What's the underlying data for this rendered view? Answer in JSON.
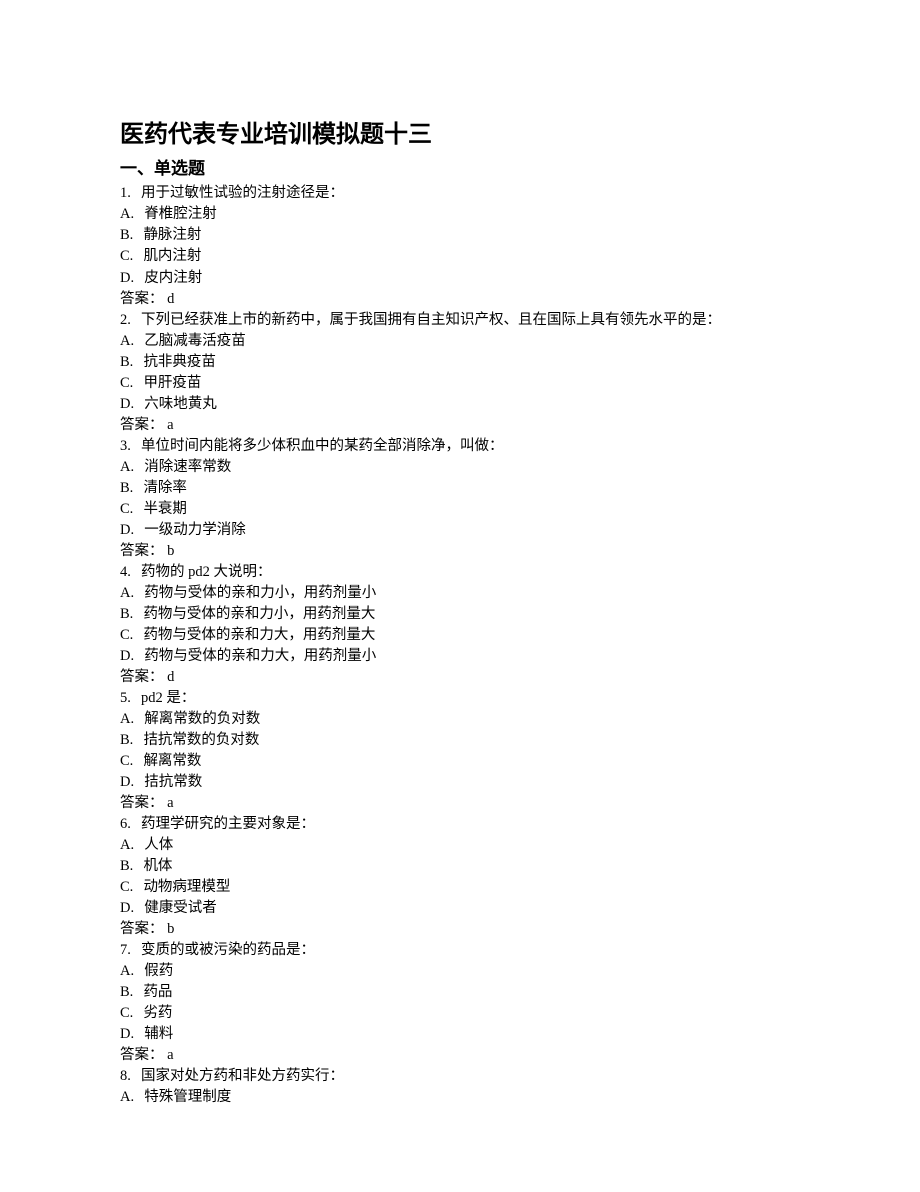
{
  "title": "医药代表专业培训模拟题十三",
  "section": "一、单选题",
  "answer_label": "答案：",
  "questions": [
    {
      "num": "1.",
      "stem": "用于过敏性试验的注射途径是：",
      "options": [
        {
          "letter": "A.",
          "text": "脊椎腔注射"
        },
        {
          "letter": "B.",
          "text": "静脉注射"
        },
        {
          "letter": "C.",
          "text": "肌内注射"
        },
        {
          "letter": "D.",
          "text": "皮内注射"
        }
      ],
      "answer": "d"
    },
    {
      "num": "2.",
      "stem": "下列已经获准上市的新药中，属于我国拥有自主知识产权、且在国际上具有领先水平的是：",
      "options": [
        {
          "letter": "A.",
          "text": "乙脑减毒活疫苗"
        },
        {
          "letter": "B.",
          "text": "抗非典疫苗"
        },
        {
          "letter": "C.",
          "text": "甲肝疫苗"
        },
        {
          "letter": "D.",
          "text": "六味地黄丸"
        }
      ],
      "answer": "a"
    },
    {
      "num": "3.",
      "stem": "单位时间内能将多少体积血中的某药全部消除净，叫做：",
      "options": [
        {
          "letter": "A.",
          "text": "消除速率常数"
        },
        {
          "letter": "B.",
          "text": "清除率"
        },
        {
          "letter": "C.",
          "text": "半衰期"
        },
        {
          "letter": "D.",
          "text": "一级动力学消除"
        }
      ],
      "answer": "b"
    },
    {
      "num": "4.",
      "stem": "药物的 pd2 大说明：",
      "options": [
        {
          "letter": "A.",
          "text": "药物与受体的亲和力小，用药剂量小"
        },
        {
          "letter": "B.",
          "text": "药物与受体的亲和力小，用药剂量大"
        },
        {
          "letter": "C.",
          "text": "药物与受体的亲和力大，用药剂量大"
        },
        {
          "letter": "D.",
          "text": "药物与受体的亲和力大，用药剂量小"
        }
      ],
      "answer": "d"
    },
    {
      "num": "5.",
      "stem": "pd2 是：",
      "options": [
        {
          "letter": "A.",
          "text": "解离常数的负对数"
        },
        {
          "letter": "B.",
          "text": "拮抗常数的负对数"
        },
        {
          "letter": "C.",
          "text": "解离常数"
        },
        {
          "letter": "D.",
          "text": "拮抗常数"
        }
      ],
      "answer": "a"
    },
    {
      "num": "6.",
      "stem": "药理学研究的主要对象是：",
      "options": [
        {
          "letter": "A.",
          "text": "人体"
        },
        {
          "letter": "B.",
          "text": "机体"
        },
        {
          "letter": "C.",
          "text": "动物病理模型"
        },
        {
          "letter": "D.",
          "text": "健康受试者"
        }
      ],
      "answer": "b"
    },
    {
      "num": "7.",
      "stem": "变质的或被污染的药品是：",
      "options": [
        {
          "letter": "A.",
          "text": "假药"
        },
        {
          "letter": "B.",
          "text": "药品"
        },
        {
          "letter": "C.",
          "text": "劣药"
        },
        {
          "letter": "D.",
          "text": "辅料"
        }
      ],
      "answer": "a"
    },
    {
      "num": "8.",
      "stem": "国家对处方药和非处方药实行：",
      "options": [
        {
          "letter": "A.",
          "text": "特殊管理制度"
        }
      ],
      "answer": null
    }
  ]
}
